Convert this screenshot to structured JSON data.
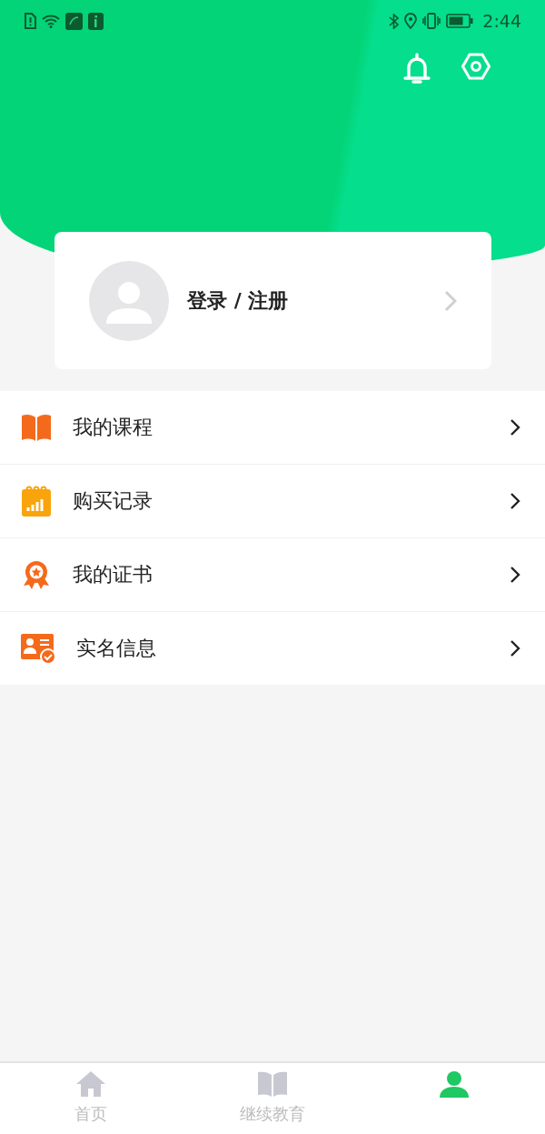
{
  "status_bar": {
    "time": "2:44"
  },
  "profile": {
    "label": "登录 / 注册"
  },
  "menu": [
    {
      "label": "我的课程"
    },
    {
      "label": "购买记录"
    },
    {
      "label": "我的证书"
    },
    {
      "label": "实名信息"
    }
  ],
  "tab_bar": [
    {
      "label": "首页",
      "selected": false
    },
    {
      "label": "继续教育",
      "selected": false
    },
    {
      "selected": true
    }
  ]
}
